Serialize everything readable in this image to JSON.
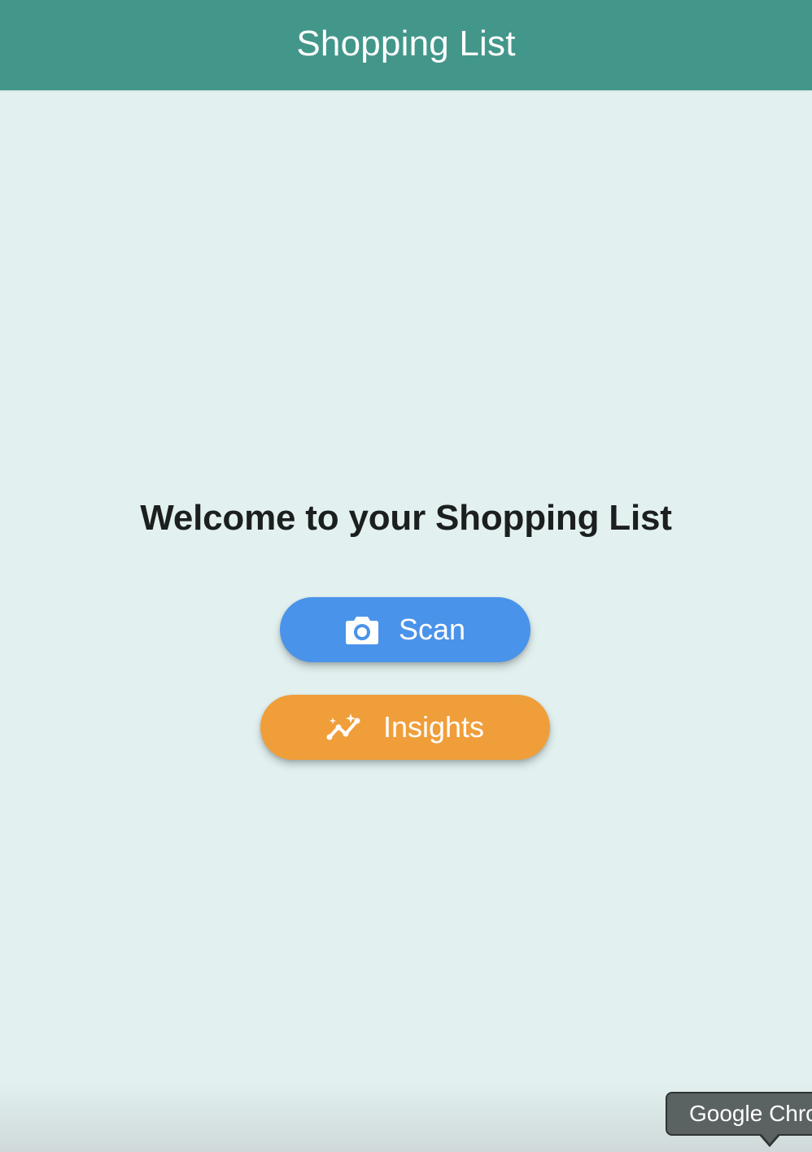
{
  "app_bar": {
    "title": "Shopping List"
  },
  "main": {
    "welcome_text": "Welcome to your Shopping List",
    "buttons": [
      {
        "label": "Scan",
        "icon": "camera-icon",
        "color": "#4a93ea"
      },
      {
        "label": "Insights",
        "icon": "insights-icon",
        "color": "#f09e3a"
      }
    ]
  },
  "tooltip": {
    "text": "Google Chrome"
  },
  "colors": {
    "app_bar": "#43968a",
    "background": "#e2f1f0",
    "text": "#1c1f1f"
  }
}
